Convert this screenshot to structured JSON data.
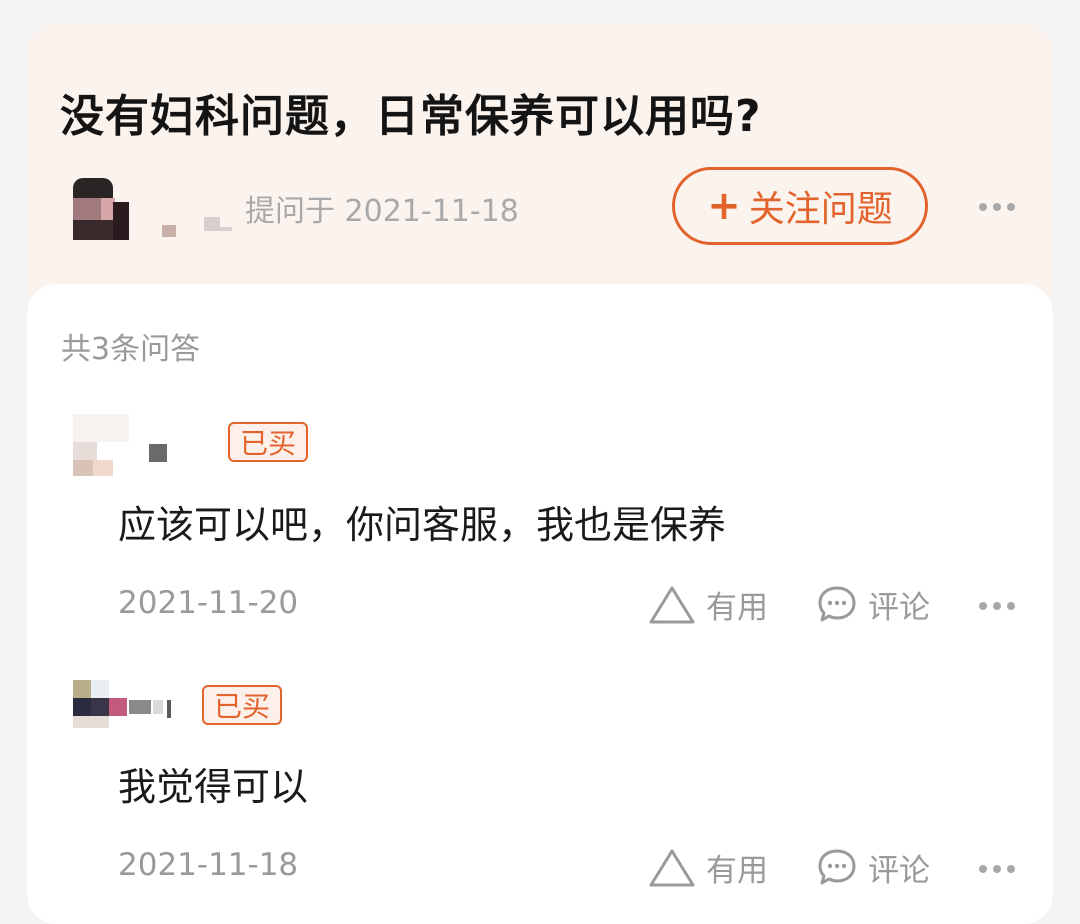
{
  "question": {
    "title": "没有妇科问题，日常保养可以用吗?",
    "asked_meta": "提问于 2021-11-18",
    "follow_plus": "+",
    "follow_label": "关注问题"
  },
  "answers_section": {
    "count_label": "共3条问答",
    "items": [
      {
        "badge": "已买",
        "text": "应该可以吧，你问客服，我也是保养",
        "date": "2021-11-20",
        "useful_label": "有用",
        "comment_label": "评论"
      },
      {
        "badge": "已买",
        "text": "我觉得可以",
        "date": "2021-11-18",
        "useful_label": "有用",
        "comment_label": "评论"
      }
    ]
  },
  "icons": [
    "more-icon",
    "useful-triangle-icon",
    "comment-bubble-icon"
  ],
  "colors": {
    "accent": "#e3632c",
    "question_bg": "#fbf3ee",
    "muted_text": "#9a9a9a"
  }
}
